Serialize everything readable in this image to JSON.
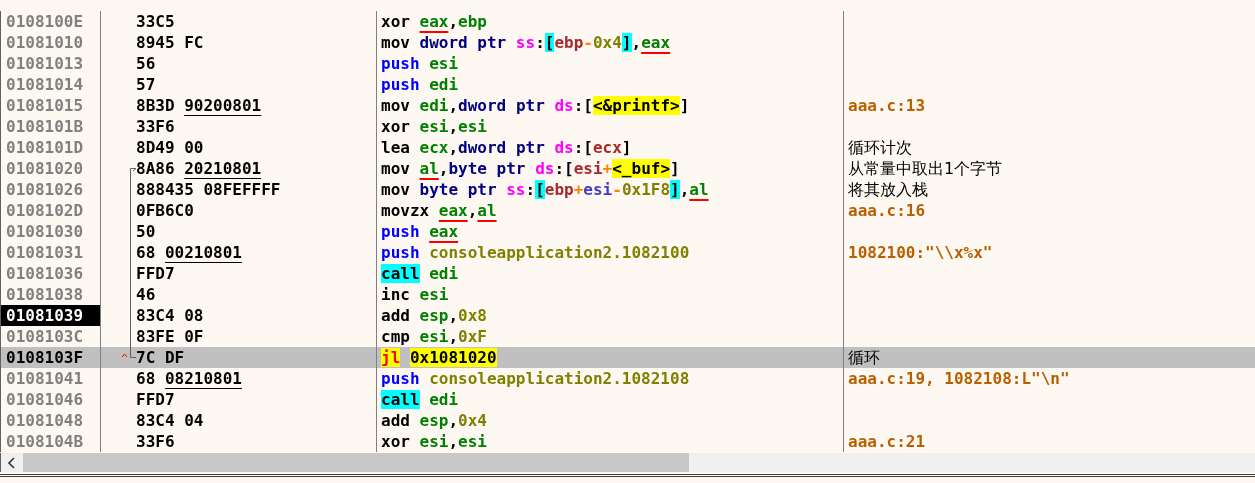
{
  "rows": [
    {
      "address": "0108100E",
      "bytes": "33C5",
      "selected": false,
      "eip": false,
      "instruction": [
        {
          "text": "xor ",
          "kind": "op"
        },
        {
          "text": "eax",
          "kind": "regw"
        },
        {
          "text": ",",
          "kind": "punct"
        },
        {
          "text": "ebp",
          "kind": "reg"
        }
      ]
    },
    {
      "address": "01081010",
      "bytes": "8945 FC",
      "selected": false,
      "eip": false,
      "instruction": [
        {
          "text": "mov ",
          "kind": "op"
        },
        {
          "text": "dword ptr ",
          "kind": "size"
        },
        {
          "text": "ss",
          "kind": "seg"
        },
        {
          "text": ":",
          "kind": "punct"
        },
        {
          "text": "[",
          "kind": "bracket"
        },
        {
          "text": "ebp",
          "kind": "memreg"
        },
        {
          "text": "-",
          "kind": "sign"
        },
        {
          "text": "0x4",
          "kind": "num"
        },
        {
          "text": "]",
          "kind": "bracket"
        },
        {
          "text": ",",
          "kind": "punct"
        },
        {
          "text": "eax",
          "kind": "regw"
        }
      ]
    },
    {
      "address": "01081013",
      "bytes": "56",
      "selected": false,
      "eip": false,
      "instruction": [
        {
          "text": "push ",
          "kind": "push"
        },
        {
          "text": "esi",
          "kind": "reg"
        }
      ]
    },
    {
      "address": "01081014",
      "bytes": "57",
      "selected": false,
      "eip": false,
      "instruction": [
        {
          "text": "push ",
          "kind": "push"
        },
        {
          "text": "edi",
          "kind": "reg"
        }
      ]
    },
    {
      "address": "01081015",
      "bytes": "8B3D",
      "reference": "90200801",
      "selected": false,
      "eip": false,
      "instruction": [
        {
          "text": "mov ",
          "kind": "op"
        },
        {
          "text": "edi",
          "kind": "reg"
        },
        {
          "text": ",",
          "kind": "punct"
        },
        {
          "text": "dword ptr ",
          "kind": "size"
        },
        {
          "text": "ds",
          "kind": "seg"
        },
        {
          "text": ":",
          "kind": "punct"
        },
        {
          "text": "[",
          "kind": "punct"
        },
        {
          "text": "<&printf>",
          "kind": "sym"
        },
        {
          "text": "]",
          "kind": "punct"
        }
      ],
      "comment": {
        "text": "aaa.c:13",
        "kind": "source"
      }
    },
    {
      "address": "0108101B",
      "bytes": "33F6",
      "selected": false,
      "eip": false,
      "instruction": [
        {
          "text": "xor ",
          "kind": "op"
        },
        {
          "text": "esi",
          "kind": "reg"
        },
        {
          "text": ",",
          "kind": "punct"
        },
        {
          "text": "esi",
          "kind": "reg"
        }
      ]
    },
    {
      "address": "0108101D",
      "bytes": "8D49 00",
      "selected": false,
      "eip": false,
      "instruction": [
        {
          "text": "lea ",
          "kind": "op"
        },
        {
          "text": "ecx",
          "kind": "reg"
        },
        {
          "text": ",",
          "kind": "punct"
        },
        {
          "text": "dword ptr ",
          "kind": "size"
        },
        {
          "text": "ds",
          "kind": "seg"
        },
        {
          "text": ":",
          "kind": "punct"
        },
        {
          "text": "[",
          "kind": "punct"
        },
        {
          "text": "ecx",
          "kind": "memreg"
        },
        {
          "text": "]",
          "kind": "punct"
        }
      ],
      "comment": {
        "text": "循环计次",
        "kind": "note"
      }
    },
    {
      "address": "01081020",
      "bytes": "8A86",
      "reference": "20210801",
      "kind": "jump_target",
      "selected": false,
      "eip": false,
      "instruction": [
        {
          "text": "mov ",
          "kind": "op"
        },
        {
          "text": "al",
          "kind": "regw"
        },
        {
          "text": ",",
          "kind": "punct"
        },
        {
          "text": "byte ptr ",
          "kind": "size"
        },
        {
          "text": "ds",
          "kind": "seg"
        },
        {
          "text": ":",
          "kind": "punct"
        },
        {
          "text": "[",
          "kind": "punct"
        },
        {
          "text": "esi",
          "kind": "memreg"
        },
        {
          "text": "+",
          "kind": "sign"
        },
        {
          "text": "<_buf>",
          "kind": "sym"
        },
        {
          "text": "]",
          "kind": "punct"
        }
      ],
      "comment": {
        "text": "从常量中取出1个字节",
        "kind": "note"
      }
    },
    {
      "address": "01081026",
      "bytes": "888435 08FEFFFF",
      "selected": false,
      "eip": false,
      "instruction": [
        {
          "text": "mov ",
          "kind": "op"
        },
        {
          "text": "byte ptr ",
          "kind": "size"
        },
        {
          "text": "ss",
          "kind": "seg"
        },
        {
          "text": ":",
          "kind": "punct"
        },
        {
          "text": "[",
          "kind": "bracket"
        },
        {
          "text": "ebp",
          "kind": "memreg"
        },
        {
          "text": "+",
          "kind": "sign"
        },
        {
          "text": "esi",
          "kind": "index"
        },
        {
          "text": "-",
          "kind": "sign"
        },
        {
          "text": "0x1F8",
          "kind": "num"
        },
        {
          "text": "]",
          "kind": "bracket"
        },
        {
          "text": ",",
          "kind": "punct"
        },
        {
          "text": "al",
          "kind": "regw"
        }
      ],
      "comment": {
        "text": "将其放入栈",
        "kind": "note"
      }
    },
    {
      "address": "0108102D",
      "bytes": "0FB6C0",
      "selected": false,
      "eip": false,
      "instruction": [
        {
          "text": "movzx ",
          "kind": "op"
        },
        {
          "text": "eax",
          "kind": "regw"
        },
        {
          "text": ",",
          "kind": "punct"
        },
        {
          "text": "al",
          "kind": "regw"
        }
      ],
      "comment": {
        "text": "aaa.c:16",
        "kind": "source"
      }
    },
    {
      "address": "01081030",
      "bytes": "50",
      "selected": false,
      "eip": false,
      "instruction": [
        {
          "text": "push ",
          "kind": "push"
        },
        {
          "text": "eax",
          "kind": "regw"
        }
      ]
    },
    {
      "address": "01081031",
      "bytes": "68",
      "reference": "00210801",
      "selected": false,
      "eip": false,
      "instruction": [
        {
          "text": "push ",
          "kind": "push"
        },
        {
          "text": "consoleapplication2.1082100",
          "kind": "num"
        }
      ],
      "comment": {
        "text": "1082100:\"\\\\x%x\"",
        "kind": "source"
      }
    },
    {
      "address": "01081036",
      "bytes": "FFD7",
      "selected": false,
      "eip": false,
      "instruction": [
        {
          "text": "call",
          "kind": "call"
        },
        {
          "text": "edi",
          "kind": "reg"
        }
      ]
    },
    {
      "address": "01081038",
      "bytes": "46",
      "selected": false,
      "eip": false,
      "instruction": [
        {
          "text": "inc ",
          "kind": "op"
        },
        {
          "text": "esi",
          "kind": "reg"
        }
      ]
    },
    {
      "address": "01081039",
      "bytes": "83C4 08",
      "selected": false,
      "eip": true,
      "instruction": [
        {
          "text": "add ",
          "kind": "op"
        },
        {
          "text": "esp",
          "kind": "reg"
        },
        {
          "text": ",",
          "kind": "punct"
        },
        {
          "text": "0x8",
          "kind": "num"
        }
      ]
    },
    {
      "address": "0108103C",
      "bytes": "83FE 0F",
      "selected": false,
      "eip": false,
      "instruction": [
        {
          "text": "cmp ",
          "kind": "op"
        },
        {
          "text": "esi",
          "kind": "reg"
        },
        {
          "text": ",",
          "kind": "punct"
        },
        {
          "text": "0xF",
          "kind": "num"
        }
      ]
    },
    {
      "address": "0108103F",
      "bytes": "7C DF",
      "kind": "jump_source",
      "selected": true,
      "eip": false,
      "instruction": [
        {
          "text": "jl",
          "kind": "jcc"
        },
        {
          "text": "0x1081020",
          "kind": "sym"
        }
      ],
      "comment": {
        "text": "循环",
        "kind": "note"
      }
    },
    {
      "address": "01081041",
      "bytes": "68",
      "reference": "08210801",
      "selected": false,
      "eip": false,
      "instruction": [
        {
          "text": "push ",
          "kind": "push"
        },
        {
          "text": "consoleapplication2.1082108",
          "kind": "num"
        }
      ],
      "comment": {
        "text": "aaa.c:19, 1082108:L\"\\n\"",
        "kind": "source"
      }
    },
    {
      "address": "01081046",
      "bytes": "FFD7",
      "selected": false,
      "eip": false,
      "instruction": [
        {
          "text": "call",
          "kind": "call"
        },
        {
          "text": "edi",
          "kind": "reg"
        }
      ]
    },
    {
      "address": "01081048",
      "bytes": "83C4 04",
      "selected": false,
      "eip": false,
      "instruction": [
        {
          "text": "add ",
          "kind": "op"
        },
        {
          "text": "esp",
          "kind": "reg"
        },
        {
          "text": ",",
          "kind": "punct"
        },
        {
          "text": "0x4",
          "kind": "num"
        }
      ]
    },
    {
      "address": "0108104B",
      "bytes": "33F6",
      "selected": false,
      "eip": false,
      "instruction": [
        {
          "text": "xor ",
          "kind": "op"
        },
        {
          "text": "esi",
          "kind": "reg"
        },
        {
          "text": ",",
          "kind": "punct"
        },
        {
          "text": "esi",
          "kind": "reg"
        }
      ],
      "comment": {
        "text": "aaa.c:21",
        "kind": "source"
      }
    }
  ]
}
